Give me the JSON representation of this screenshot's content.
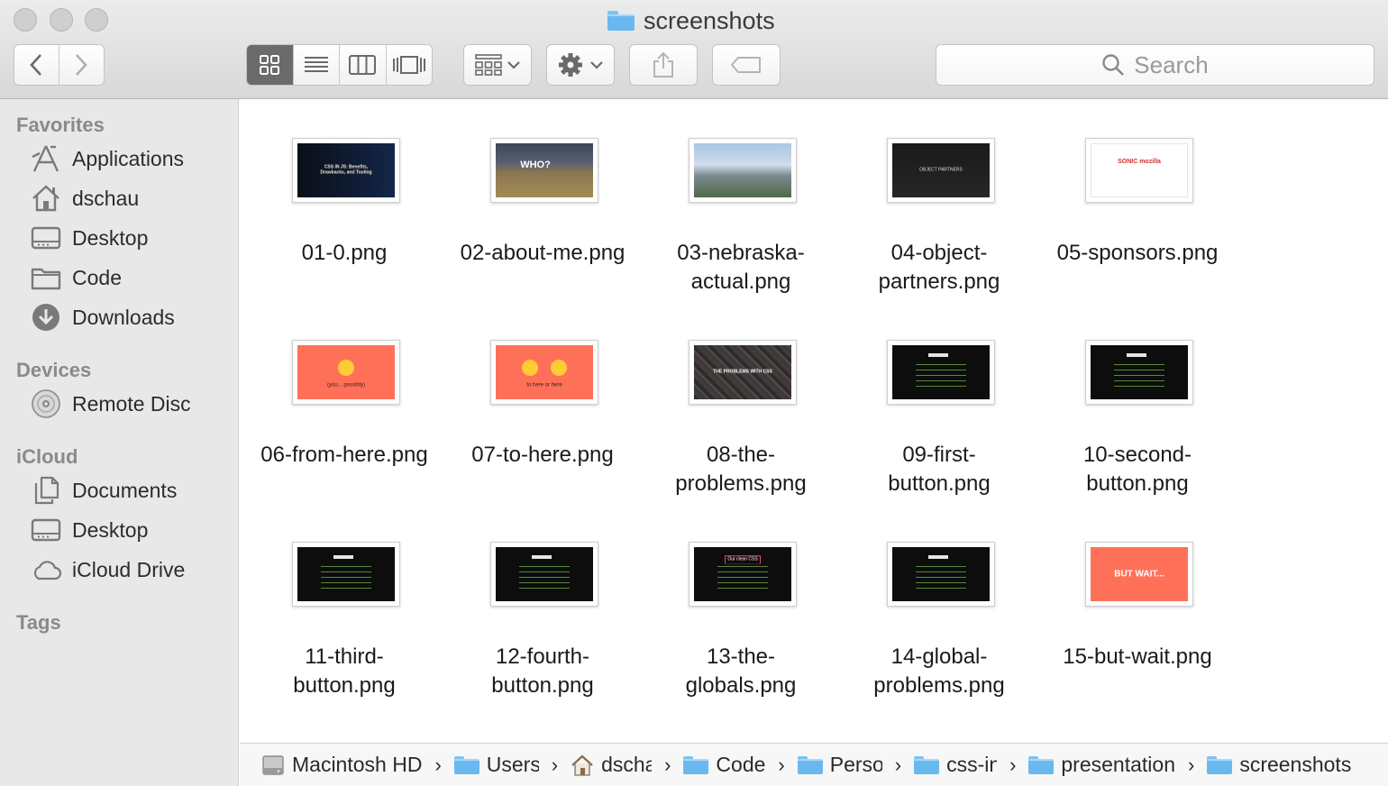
{
  "window": {
    "title": "screenshots"
  },
  "toolbar": {
    "search_placeholder": "Search",
    "view_modes": [
      "icon",
      "list",
      "column",
      "cover-flow"
    ],
    "active_view": "icon"
  },
  "sidebar": {
    "sections": [
      {
        "title": "Favorites",
        "items": [
          {
            "label": "Applications",
            "icon": "applications-icon"
          },
          {
            "label": "dschau",
            "icon": "home-icon"
          },
          {
            "label": "Desktop",
            "icon": "desktop-icon"
          },
          {
            "label": "Code",
            "icon": "folder-icon"
          },
          {
            "label": "Downloads",
            "icon": "downloads-icon"
          }
        ]
      },
      {
        "title": "Devices",
        "items": [
          {
            "label": "Remote Disc",
            "icon": "disc-icon"
          }
        ]
      },
      {
        "title": "iCloud",
        "items": [
          {
            "label": "Documents",
            "icon": "documents-icon"
          },
          {
            "label": "Desktop",
            "icon": "desktop-icon"
          },
          {
            "label": "iCloud Drive",
            "icon": "cloud-icon"
          }
        ]
      },
      {
        "title": "Tags",
        "items": []
      }
    ]
  },
  "files": [
    {
      "line1": "01-0.png",
      "line2": "",
      "thumb": "dark-blue",
      "thumb_text": "CSS IN JS: Benefits, Drawbacks, and Tooling"
    },
    {
      "line1": "02-about-me.png",
      "line2": "",
      "thumb": "field",
      "thumb_text": "WHO?"
    },
    {
      "line1": "03-nebraska-",
      "line2": "actual.png",
      "thumb": "city",
      "thumb_text": ""
    },
    {
      "line1": "04-object-",
      "line2": "partners.png",
      "thumb": "dark",
      "thumb_text": "OBJECT PARTNERS"
    },
    {
      "line1": "05-sponsors.png",
      "line2": "",
      "thumb": "white",
      "thumb_text": "SONIC mozilla"
    },
    {
      "line1": "06-from-here.png",
      "line2": "",
      "thumb": "coral",
      "thumb_text": "(you... possibly)"
    },
    {
      "line1": "07-to-here.png",
      "line2": "",
      "thumb": "coral",
      "thumb_text": "to here   or here"
    },
    {
      "line1": "08-the-",
      "line2": "problems.png",
      "thumb": "texture",
      "thumb_text": "THE PROBLEMS WITH CSS"
    },
    {
      "line1": "09-first-",
      "line2": "button.png",
      "thumb": "code",
      "thumb_text": ""
    },
    {
      "line1": "10-second-",
      "line2": "button.png",
      "thumb": "code",
      "thumb_text": ""
    },
    {
      "line1": "11-third-",
      "line2": "button.png",
      "thumb": "code",
      "thumb_text": ""
    },
    {
      "line1": "12-fourth-",
      "line2": "button.png",
      "thumb": "code",
      "thumb_text": ""
    },
    {
      "line1": "13-the-",
      "line2": "globals.png",
      "thumb": "code-pink",
      "thumb_text": "Our clean CSS"
    },
    {
      "line1": "14-global-",
      "line2": "problems.png",
      "thumb": "code",
      "thumb_text": ""
    },
    {
      "line1": "15-but-wait.png",
      "line2": "",
      "thumb": "coral",
      "thumb_text": "BUT WAIT..."
    }
  ],
  "pathbar": {
    "crumbs": [
      {
        "label": "Macintosh HD",
        "icon": "hard-drive-icon"
      },
      {
        "label": "Users",
        "icon": "users-folder-icon"
      },
      {
        "label": "dschau",
        "icon": "home-icon"
      },
      {
        "label": "Code",
        "icon": "folder-icon"
      },
      {
        "label": "Personal",
        "icon": "folder-icon"
      },
      {
        "label": "css-in-js",
        "icon": "folder-icon"
      },
      {
        "label": "presentation",
        "icon": "folder-icon"
      },
      {
        "label": "screenshots",
        "icon": "folder-icon"
      }
    ]
  },
  "colors": {
    "folder_blue": "#6ab8f0",
    "coral": "#ff7059",
    "active_segment": "#6b6b6b"
  }
}
